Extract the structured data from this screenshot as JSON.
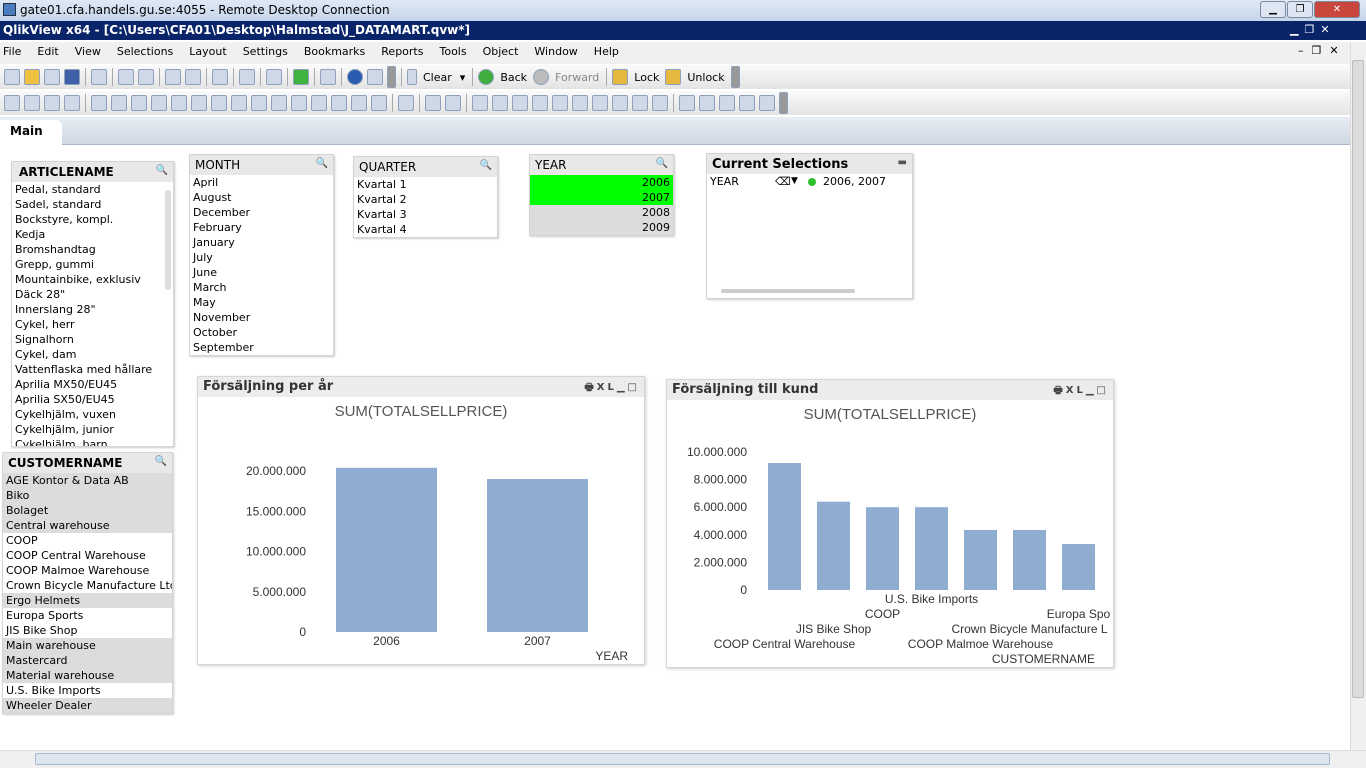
{
  "rdp": {
    "title": "gate01.cfa.handels.gu.se:4055 - Remote Desktop Connection"
  },
  "app": {
    "title": "QlikView x64 - [C:\\Users\\CFA01\\Desktop\\Halmstad\\J_DATAMART.qvw*]"
  },
  "menu": [
    "File",
    "Edit",
    "View",
    "Selections",
    "Layout",
    "Settings",
    "Bookmarks",
    "Reports",
    "Tools",
    "Object",
    "Window",
    "Help"
  ],
  "toolbar": {
    "clear": "Clear",
    "back": "Back",
    "forward": "Forward",
    "lock": "Lock",
    "unlock": "Unlock"
  },
  "tabs": [
    {
      "label": "Main",
      "active": true
    }
  ],
  "articlename": {
    "title": "ARTICLENAME",
    "items": [
      "Pedal, standard",
      "Sadel, standard",
      "Bockstyre, kompl.",
      "Kedja",
      "Bromshandtag",
      "Grepp, gummi",
      "Mountainbike, exklusiv",
      "Däck 28\"",
      "Innerslang 28\"",
      "Cykel, herr",
      "Signalhorn",
      "Cykel, dam",
      "Vattenflaska med hållare",
      "Aprilia MX50/EU45",
      "Aprilia SX50/EU45",
      "Cykelhjälm, vuxen",
      "Cykelhjälm, junior",
      "Cykelhjälm, barn"
    ]
  },
  "month": {
    "title": "MONTH",
    "items": [
      "April",
      "August",
      "December",
      "February",
      "January",
      "July",
      "June",
      "March",
      "May",
      "November",
      "October",
      "September"
    ]
  },
  "quarter": {
    "title": "QUARTER",
    "items": [
      "Kvartal 1",
      "Kvartal 2",
      "Kvartal 3",
      "Kvartal 4"
    ]
  },
  "year": {
    "title": "YEAR",
    "items": [
      {
        "v": "2006",
        "state": "selected"
      },
      {
        "v": "2007",
        "state": "selected"
      },
      {
        "v": "2008",
        "state": "excluded"
      },
      {
        "v": "2009",
        "state": "excluded"
      }
    ]
  },
  "current_selections": {
    "title": "Current Selections",
    "field": "YEAR",
    "values": "2006, 2007"
  },
  "customername": {
    "title": "CUSTOMERNAME",
    "items": [
      {
        "v": "AGE Kontor & Data AB",
        "state": "excluded"
      },
      {
        "v": "Biko",
        "state": "excluded"
      },
      {
        "v": "Bolaget",
        "state": "excluded"
      },
      {
        "v": "Central warehouse",
        "state": "excluded"
      },
      {
        "v": "COOP",
        "state": "possible"
      },
      {
        "v": "COOP Central Warehouse",
        "state": "possible"
      },
      {
        "v": "COOP Malmoe Warehouse",
        "state": "possible"
      },
      {
        "v": "Crown Bicycle Manufacture Ltd.",
        "state": "possible"
      },
      {
        "v": "Ergo Helmets",
        "state": "excluded"
      },
      {
        "v": "Europa Sports",
        "state": "possible"
      },
      {
        "v": "JIS Bike Shop",
        "state": "possible"
      },
      {
        "v": "Main warehouse",
        "state": "excluded"
      },
      {
        "v": "Mastercard",
        "state": "excluded"
      },
      {
        "v": "Material warehouse",
        "state": "excluded"
      },
      {
        "v": "U.S. Bike Imports",
        "state": "possible"
      },
      {
        "v": "Wheeler Dealer",
        "state": "excluded"
      }
    ]
  },
  "colors": {
    "bar": "#8fadd1",
    "selected": "#00ff00",
    "excluded": "#dcdcdc",
    "titlebar": "#0a246a"
  },
  "chart_data": [
    {
      "type": "bar",
      "caption": "Försäljning per år",
      "title": "SUM(TOTALSELLPRICE)",
      "xlabel": "YEAR",
      "ylabel": "",
      "categories": [
        "2006",
        "2007"
      ],
      "values": [
        20400000,
        19000000
      ],
      "ylim": [
        0,
        20000000
      ],
      "yticks": [
        "0",
        "5.000.000",
        "10.000.000",
        "15.000.000",
        "20.000.000"
      ],
      "grid": false
    },
    {
      "type": "bar",
      "caption": "Försäljning till kund",
      "title": "SUM(TOTALSELLPRICE)",
      "xlabel": "CUSTOMERNAME",
      "ylabel": "",
      "categories": [
        "COOP Central Warehouse",
        "JIS Bike Shop",
        "COOP",
        "U.S. Bike Imports",
        "COOP Malmoe Warehouse",
        "Crown Bicycle Manufacture L",
        "Europa Spo"
      ],
      "values": [
        9200000,
        6400000,
        6000000,
        6000000,
        4350000,
        4350000,
        3330000
      ],
      "ylim": [
        0,
        10000000
      ],
      "yticks": [
        "0",
        "2.000.000",
        "4.000.000",
        "6.000.000",
        "8.000.000",
        "10.000.000"
      ],
      "grid": false
    }
  ]
}
